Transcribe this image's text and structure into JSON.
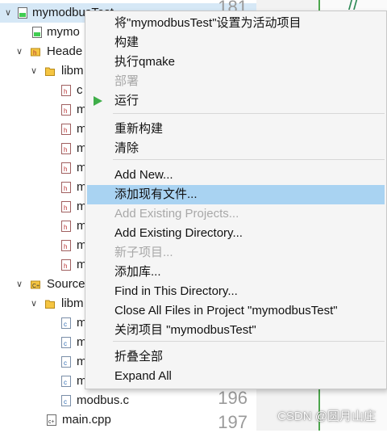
{
  "tree": {
    "project": "mymodbusTest",
    "pro_file": "mymo",
    "headers": "Heade",
    "headers_sub": "libm",
    "header_files": [
      "c",
      "m",
      "m",
      "m",
      "m",
      "m",
      "m",
      "m",
      "m",
      "m"
    ],
    "sources": "Source",
    "sources_sub": "libm",
    "source_files": [
      "m",
      "m",
      "m",
      "m"
    ],
    "source_last": "modbus.c",
    "main_file": "main.cpp"
  },
  "editor": {
    "line_numbers": [
      "181",
      "196",
      "197"
    ],
    "comment_fragment": "//"
  },
  "context_menu": {
    "items": [
      {
        "label": "将\"mymodbusTest\"设置为活动项目",
        "disabled": false
      },
      {
        "label": "构建",
        "disabled": false
      },
      {
        "label": "执行qmake",
        "disabled": false
      },
      {
        "label": "部署",
        "disabled": true
      },
      {
        "label": "运行",
        "disabled": false,
        "icon": "run-icon"
      },
      {
        "label": "重新构建",
        "disabled": false
      },
      {
        "label": "清除",
        "disabled": false
      },
      {
        "label": "Add New...",
        "disabled": false
      },
      {
        "label": "添加现有文件...",
        "disabled": false,
        "highlighted": true
      },
      {
        "label": "Add Existing Projects...",
        "disabled": true
      },
      {
        "label": "Add Existing Directory...",
        "disabled": false
      },
      {
        "label": "新子项目...",
        "disabled": true
      },
      {
        "label": "添加库...",
        "disabled": false
      },
      {
        "label": "Find in This Directory...",
        "disabled": false
      },
      {
        "label": "Close All Files in Project \"mymodbusTest\"",
        "disabled": false
      },
      {
        "label": "关闭项目 \"mymodbusTest\"",
        "disabled": false
      },
      {
        "label": "折叠全部",
        "disabled": false
      },
      {
        "label": "Expand All",
        "disabled": false
      }
    ]
  },
  "watermark": "CSDN @圆月山庄",
  "colors": {
    "highlight": "#a9d3f2",
    "selection": "#d6e8f6",
    "run_icon": "#3fae49",
    "disabled_text": "#a8a8a8"
  }
}
